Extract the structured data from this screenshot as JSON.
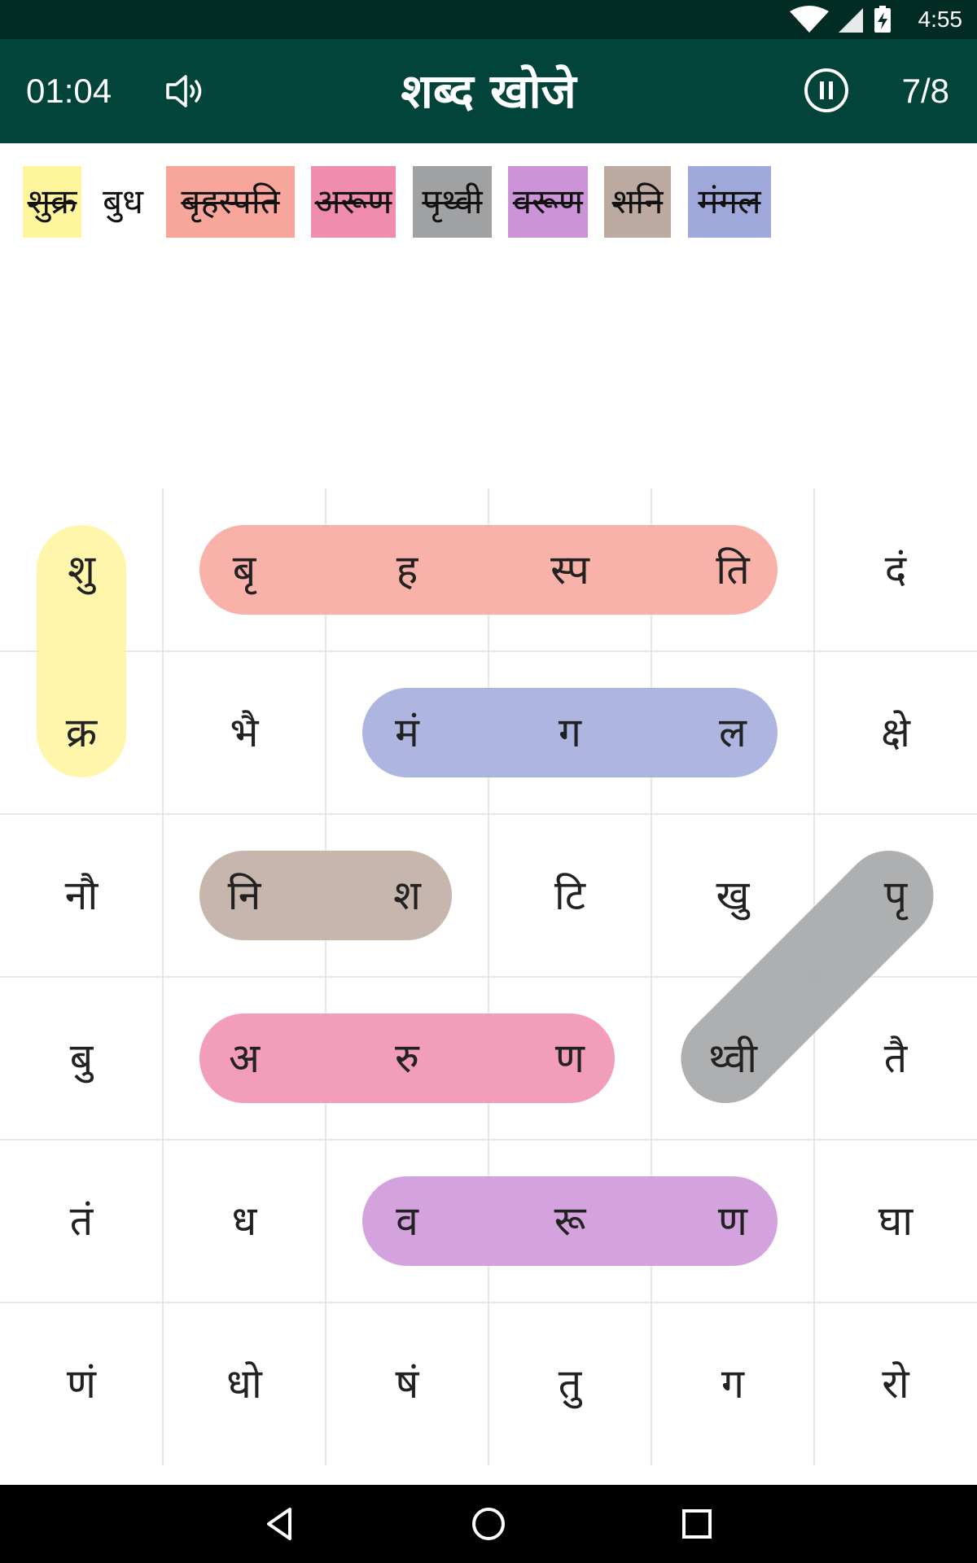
{
  "status_bar": {
    "time": "4:55",
    "icons": [
      "wifi-icon",
      "cell-signal-icon",
      "battery-charging-icon"
    ]
  },
  "toolbar": {
    "timer": "01:04",
    "title": "शब्द  खोजे",
    "progress": "7/8",
    "icons": [
      "speaker-icon",
      "pause-icon"
    ]
  },
  "words": [
    {
      "text": "शुक्र",
      "found": true,
      "color": "#fff59d"
    },
    {
      "text": "बुध",
      "found": false,
      "color": ""
    },
    {
      "text": "बृहस्पति",
      "found": true,
      "color": "#f8a59b"
    },
    {
      "text": "अरूण",
      "found": true,
      "color": "#f08cae"
    },
    {
      "text": "पृथ्वी",
      "found": true,
      "color": "#9fa1a3"
    },
    {
      "text": "वरूण",
      "found": true,
      "color": "#cc93d8"
    },
    {
      "text": "शनि",
      "found": true,
      "color": "#bca99f"
    },
    {
      "text": "मंगल",
      "found": true,
      "color": "#9fa8da"
    }
  ],
  "grid": {
    "rows": [
      [
        "शु",
        "बृ",
        "ह",
        "स्प",
        "ति",
        "दं"
      ],
      [
        "क्र",
        "भै",
        "मं",
        "ग",
        "ल",
        "क्षे"
      ],
      [
        "नौ",
        "नि",
        "श",
        "टि",
        "खु",
        "पृ"
      ],
      [
        "बु",
        "अ",
        "रु",
        "ण",
        "थ्वी",
        "तै"
      ],
      [
        "तं",
        "ध",
        "व",
        "रू",
        "ण",
        "घा"
      ],
      [
        "णं",
        "धो",
        "षं",
        "तु",
        "ग",
        "रो"
      ]
    ]
  },
  "nav_bar": {
    "icons": [
      "back-icon",
      "home-icon",
      "recents-icon"
    ]
  }
}
